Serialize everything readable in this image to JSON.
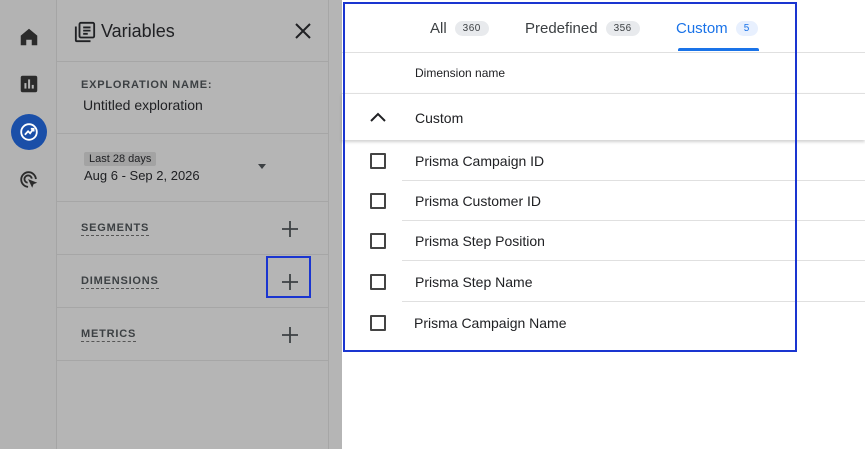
{
  "rail": {
    "items": [
      {
        "name": "home",
        "icon": "home-icon"
      },
      {
        "name": "reports",
        "icon": "bar-chart-icon"
      },
      {
        "name": "explore",
        "icon": "explore-icon"
      },
      {
        "name": "advertising",
        "icon": "target-cursor-icon"
      }
    ],
    "active_color": "#1a4fa8"
  },
  "variables": {
    "title": "Variables",
    "exploration_name_label": "EXPLORATION NAME:",
    "exploration_name_value": "Untitled exploration",
    "date_chip": "Last 28 days",
    "date_range": "Aug 6 - Sep 2, 2026",
    "sections": [
      {
        "label": "SEGMENTS"
      },
      {
        "label": "DIMENSIONS"
      },
      {
        "label": "METRICS"
      }
    ]
  },
  "picker": {
    "tabs": [
      {
        "label": "All",
        "count": "360"
      },
      {
        "label": "Predefined",
        "count": "356"
      },
      {
        "label": "Custom",
        "count": "5"
      }
    ],
    "active_tab": "Custom",
    "column_header": "Dimension name",
    "group_label": "Custom",
    "dimensions": [
      {
        "label": "Prisma Campaign ID",
        "checked": false
      },
      {
        "label": "Prisma Customer ID",
        "checked": false
      },
      {
        "label": "Prisma Step Position",
        "checked": false
      },
      {
        "label": "Prisma Step Name",
        "checked": false
      },
      {
        "label": "Prisma Campaign Name",
        "checked": false
      }
    ],
    "accent_color": "#1a73e8",
    "highlight_color": "#1a35d0"
  }
}
